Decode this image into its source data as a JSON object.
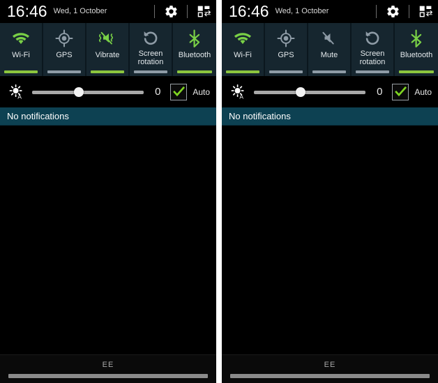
{
  "statusbar": {
    "time": "16:46",
    "date": "Wed, 1 October",
    "settings_icon": "gear-icon",
    "edit_toggles_icon": "toggle-grid-icon"
  },
  "brightness": {
    "icon": "auto-brightness-icon",
    "value": "0",
    "auto_label": "Auto",
    "auto_checked": true,
    "slider_percent": 42
  },
  "notifications": {
    "empty_text": "No notifications"
  },
  "carrier": {
    "name": "EE"
  },
  "colors": {
    "accent_green": "#8cc63e",
    "icon_green": "#79d046",
    "inactive_gray": "#8e9ba6",
    "panel_bg": "#16262f",
    "notif_bar": "#0d4152"
  },
  "panels": [
    {
      "id": "left",
      "toggles": [
        {
          "label": "Wi-Fi",
          "icon": "wifi-icon",
          "active": true
        },
        {
          "label": "GPS",
          "icon": "gps-icon",
          "active": false
        },
        {
          "label": "Vibrate",
          "icon": "vibrate-icon",
          "active": true
        },
        {
          "label": "Screen\nrotation",
          "icon": "screen-rotation-icon",
          "active": false
        },
        {
          "label": "Bluetooth",
          "icon": "bluetooth-icon",
          "active": true
        }
      ]
    },
    {
      "id": "right",
      "toggles": [
        {
          "label": "Wi-Fi",
          "icon": "wifi-icon",
          "active": true
        },
        {
          "label": "GPS",
          "icon": "gps-icon",
          "active": false
        },
        {
          "label": "Mute",
          "icon": "mute-icon",
          "active": false
        },
        {
          "label": "Screen\nrotation",
          "icon": "screen-rotation-icon",
          "active": false
        },
        {
          "label": "Bluetooth",
          "icon": "bluetooth-icon",
          "active": true
        }
      ]
    }
  ]
}
